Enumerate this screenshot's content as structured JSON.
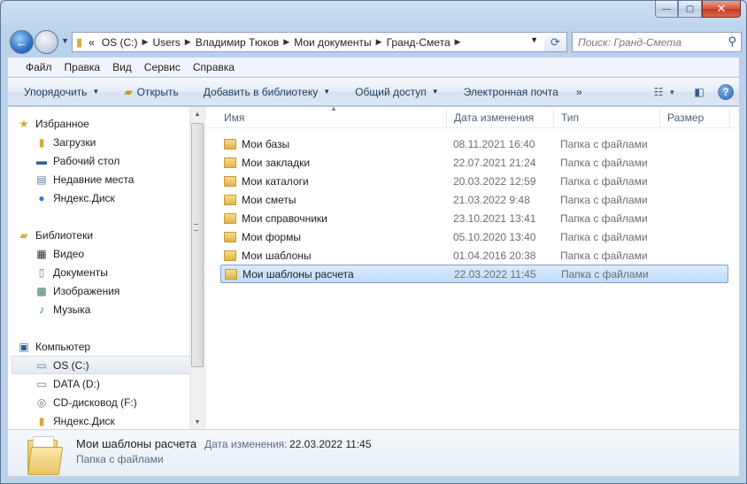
{
  "window": {
    "minimize": "—",
    "maximize": "▢",
    "close": "✕"
  },
  "nav": {
    "back_icon": "arrow-left-icon",
    "forward_icon": "arrow-right-icon",
    "refresh_icon": "refresh-icon"
  },
  "address": {
    "chevron": "«",
    "segments": [
      "OS (C:)",
      "Users",
      "Владимир Тюков",
      "Мои документы",
      "Гранд-Смета"
    ]
  },
  "search": {
    "placeholder": "Поиск: Гранд-Смета"
  },
  "menu": [
    "Файл",
    "Правка",
    "Вид",
    "Сервис",
    "Справка"
  ],
  "toolbar": {
    "organize": "Упорядочить",
    "open": "Открыть",
    "add_to_library": "Добавить в библиотеку",
    "share": "Общий доступ",
    "email": "Электронная почта",
    "more": "»"
  },
  "nav_pane": {
    "favorites": {
      "label": "Избранное",
      "items": [
        "Загрузки",
        "Рабочий стол",
        "Недавние места",
        "Яндекс.Диск"
      ]
    },
    "libraries": {
      "label": "Библиотеки",
      "items": [
        "Видео",
        "Документы",
        "Изображения",
        "Музыка"
      ]
    },
    "computer": {
      "label": "Компьютер",
      "items": [
        "OS (C:)",
        "DATA (D:)",
        "CD-дисковод (F:)",
        "Яндекс.Диск"
      ],
      "selected": "OS (C:)"
    }
  },
  "columns": {
    "name": "Имя",
    "date": "Дата изменения",
    "type": "Тип",
    "size": "Размер"
  },
  "files": [
    {
      "name": "Мои базы",
      "date": "08.11.2021 16:40",
      "type": "Папка с файлами"
    },
    {
      "name": "Мои закладки",
      "date": "22.07.2021 21:24",
      "type": "Папка с файлами"
    },
    {
      "name": "Мои каталоги",
      "date": "20.03.2022 12:59",
      "type": "Папка с файлами"
    },
    {
      "name": "Мои сметы",
      "date": "21.03.2022 9:48",
      "type": "Папка с файлами"
    },
    {
      "name": "Мои справочники",
      "date": "23.10.2021 13:41",
      "type": "Папка с файлами"
    },
    {
      "name": "Мои формы",
      "date": "05.10.2020 13:40",
      "type": "Папка с файлами"
    },
    {
      "name": "Мои шаблоны",
      "date": "01.04.2016 20:38",
      "type": "Папка с файлами"
    },
    {
      "name": "Мои шаблоны расчета",
      "date": "22.03.2022 11:45",
      "type": "Папка с файлами"
    }
  ],
  "selected_file": "Мои шаблоны расчета",
  "details": {
    "name": "Мои шаблоны расчета",
    "date_label": "Дата изменения:",
    "date_value": "22.03.2022 11:45",
    "type": "Папка с файлами"
  },
  "colors": {
    "accent": "#3a6ea5",
    "selection": "#c1dcfc",
    "folder": "#e0b44b"
  }
}
